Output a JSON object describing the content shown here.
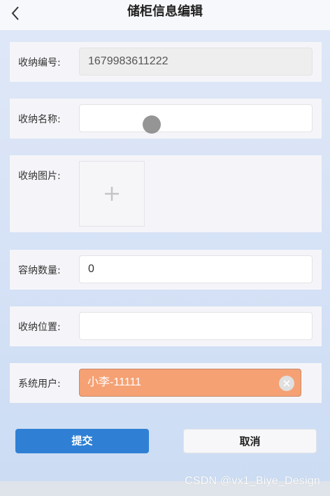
{
  "header": {
    "title": "储柜信息编辑",
    "back_icon": "chevron-left-icon"
  },
  "form": {
    "storage_number": {
      "label": "收纳编号:",
      "value": "1679983611222"
    },
    "storage_name": {
      "label": "收纳名称:",
      "value": "",
      "placeholder": ""
    },
    "storage_image": {
      "label": "收纳图片:",
      "add_icon": "plus-icon"
    },
    "capacity": {
      "label": "容纳数量:",
      "value": "0"
    },
    "location": {
      "label": "收纳位置:",
      "value": "",
      "placeholder": ""
    },
    "system_user": {
      "label": "系统用户:",
      "selected": "小李-11111",
      "accent_color": "#f5a174",
      "clear_icon": "clear-icon"
    }
  },
  "actions": {
    "submit_label": "提交",
    "cancel_label": "取消"
  },
  "watermark": "CSDN @vx1_Biye_Design",
  "colors": {
    "primary": "#2f80d4",
    "select_bg": "#f5a174"
  }
}
